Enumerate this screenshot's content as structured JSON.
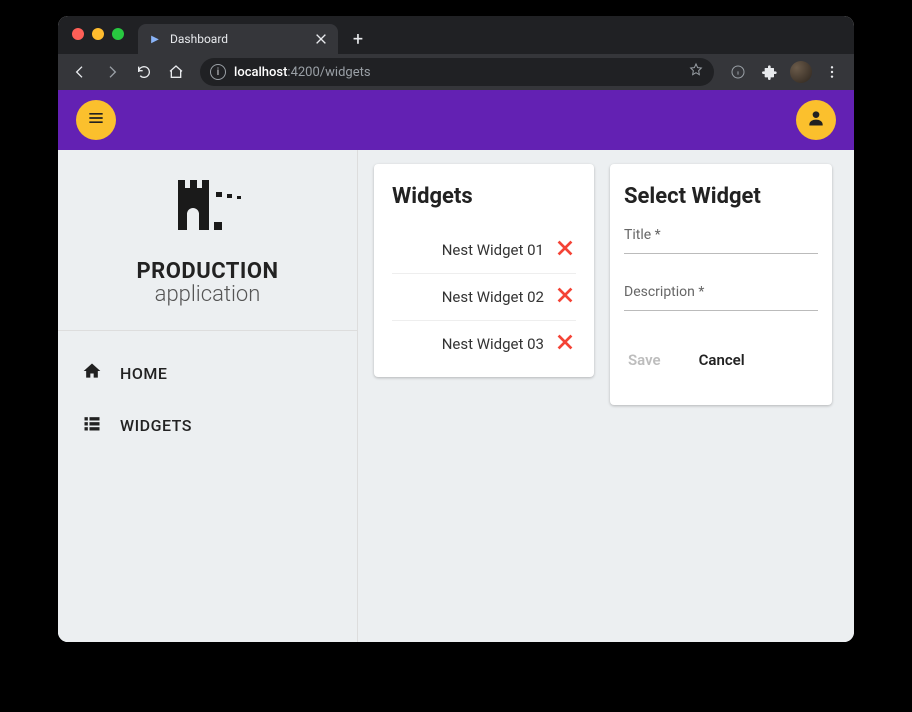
{
  "browser": {
    "tab_title": "Dashboard",
    "url_host": "localhost",
    "url_port": ":4200",
    "url_path": "/widgets"
  },
  "brand": {
    "line1": "PRODUCTION",
    "line2": "application"
  },
  "nav": {
    "home": "HOME",
    "widgets": "WIDGETS"
  },
  "widgets_card": {
    "title": "Widgets",
    "items": [
      {
        "name": "Nest Widget 01"
      },
      {
        "name": "Nest Widget 02"
      },
      {
        "name": "Nest Widget 03"
      }
    ]
  },
  "form_card": {
    "title": "Select Widget",
    "title_label": "Title *",
    "description_label": "Description *",
    "save": "Save",
    "cancel": "Cancel"
  }
}
